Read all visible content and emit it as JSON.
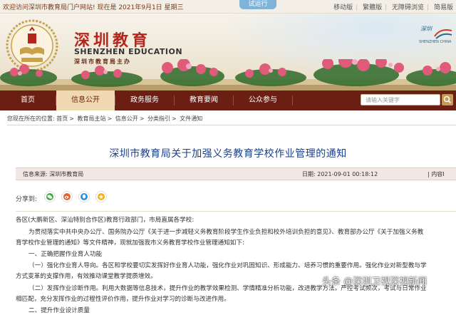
{
  "topbar": {
    "welcome": "欢迎访问深圳市教育局门户网站! 现在是 2021年9月1日 星期三",
    "trial_label": "试运行",
    "links": [
      "移动版",
      "繁體版",
      "无障碍浏览",
      "简易版"
    ]
  },
  "header": {
    "cn_name": "深圳教育",
    "en_name": "SHENZHEN EDUCATION",
    "sponsor": "深圳市教育局主办",
    "city_logo_cn": "深圳",
    "city_logo_en": "SHENZHEN CHINA"
  },
  "nav": {
    "items": [
      "首页",
      "信息公开",
      "政务服务",
      "教育要闻",
      "公众参与"
    ],
    "active_index": 1,
    "search_placeholder": "请输入关键字"
  },
  "breadcrumb": {
    "prefix": "您现在所在的位置:",
    "items": [
      "首页",
      "教育局主站",
      "信息公开",
      "分类指引",
      "文件通知"
    ]
  },
  "article": {
    "title": "深圳市教育局关于加强义务教育学校作业管理的通知",
    "source": "信息来源: 深圳市教育局",
    "date": "日期: 2021-09-01 00:18:12",
    "size_label": "| 内容I",
    "share_label": "分享到:",
    "lines": [
      "各区(大鹏新区、深汕特别合作区)教育行政部门，市局直属各学校:",
      "为贯彻落实中共中央办公厅、国务院办公厅《关于进一步减轻义务教育阶段学生作业负担和校外培训负担的意见》、教育部办公厅《关于加强义务教",
      "育学校作业管理的通知》等文件精神，现就加强我市义务教育学校作业管理通知如下:",
      "一、正确把握作业育人功能",
      "（一）强化作业育人导向。各区和学校要切实发挥好作业育人功能，强化作业对巩固知识、形成能力、培养习惯的重要作用。强化作业对新型教与学",
      "方式变革的支撑作用，有效推动课堂教学提质增效。",
      "（二）发挥作业诊断作用。利用大数据等信息技术，提升作业的教学效果检测、学情精准分析功能，改进教学方法。严控考试频次，考试与日常作业",
      "相匹配，充分发挥作业的过程性评价作用，提升作业对学习的诊断与改进作用。",
      "二、提升作业设计质量"
    ]
  },
  "watermark": "头条 @深圳卫视深视新闻",
  "colors": {
    "nav_bg": "#6b1e12",
    "nav_active_bg": "#f0d9b2",
    "title_blue": "#1a3f8a",
    "brand_red": "#b3261e"
  },
  "icons": [
    "wechat-icon",
    "weibo-icon",
    "qq-icon",
    "qzone-icon",
    "search-icon",
    "book-emblem-icon"
  ]
}
